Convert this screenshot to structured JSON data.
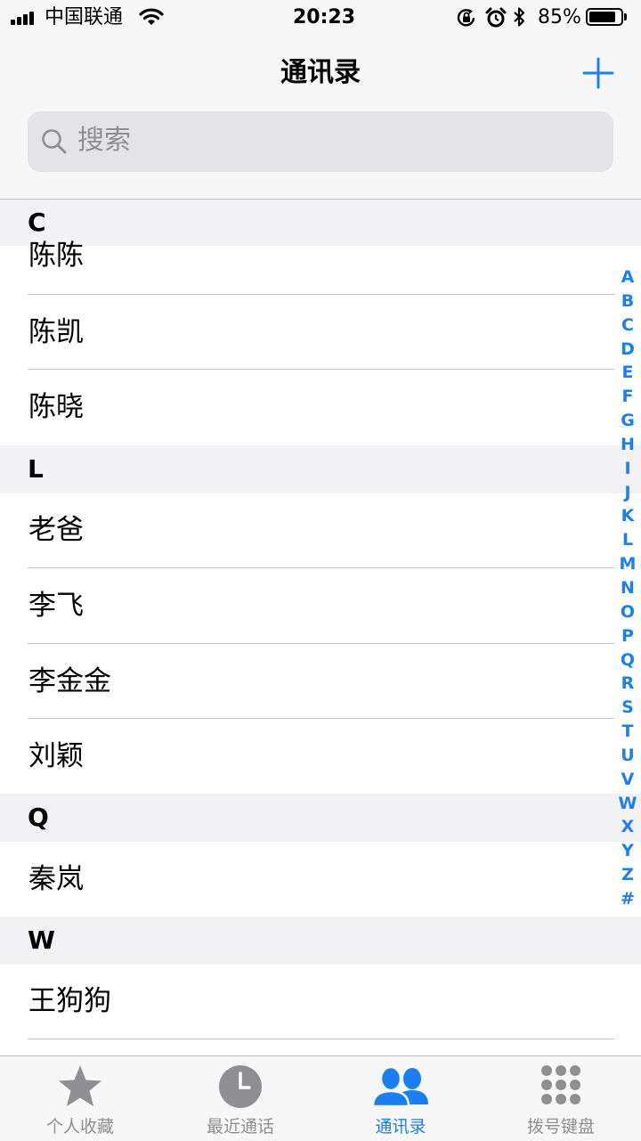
{
  "status_bar": {
    "carrier": "中国联通",
    "time": "20:23",
    "battery_percent": "85%",
    "battery_level": 0.85,
    "icons": [
      "signal-icon",
      "wifi-icon",
      "rotation-lock-icon",
      "alarm-icon",
      "bluetooth-icon",
      "battery-icon"
    ]
  },
  "header": {
    "title": "通讯录",
    "add_icon": "plus-icon",
    "search_placeholder": "搜索"
  },
  "sections": [
    {
      "letter": "C",
      "contacts": [
        "陈陈",
        "陈凯",
        "陈晓"
      ]
    },
    {
      "letter": "L",
      "contacts": [
        "老爸",
        "李飞",
        "李金金",
        "刘颖"
      ]
    },
    {
      "letter": "Q",
      "contacts": [
        "秦岚"
      ]
    },
    {
      "letter": "W",
      "contacts": [
        "王狗狗"
      ]
    }
  ],
  "index_letters": [
    "A",
    "B",
    "C",
    "D",
    "E",
    "F",
    "G",
    "H",
    "I",
    "J",
    "K",
    "L",
    "M",
    "N",
    "O",
    "P",
    "Q",
    "R",
    "S",
    "T",
    "U",
    "V",
    "W",
    "X",
    "Y",
    "Z",
    "#"
  ],
  "tabbar": {
    "tabs": [
      {
        "label": "个人收藏",
        "icon": "star-icon"
      },
      {
        "label": "最近通话",
        "icon": "clock-icon"
      },
      {
        "label": "通讯录",
        "icon": "contacts-icon"
      },
      {
        "label": "拨号键盘",
        "icon": "keypad-icon"
      }
    ],
    "active_index": 2
  },
  "colors": {
    "accent": "#1a7ff1",
    "section_bg": "#f2f2f4",
    "bar_bg": "#f7f7f7",
    "inactive_tab": "#8e8e93"
  }
}
